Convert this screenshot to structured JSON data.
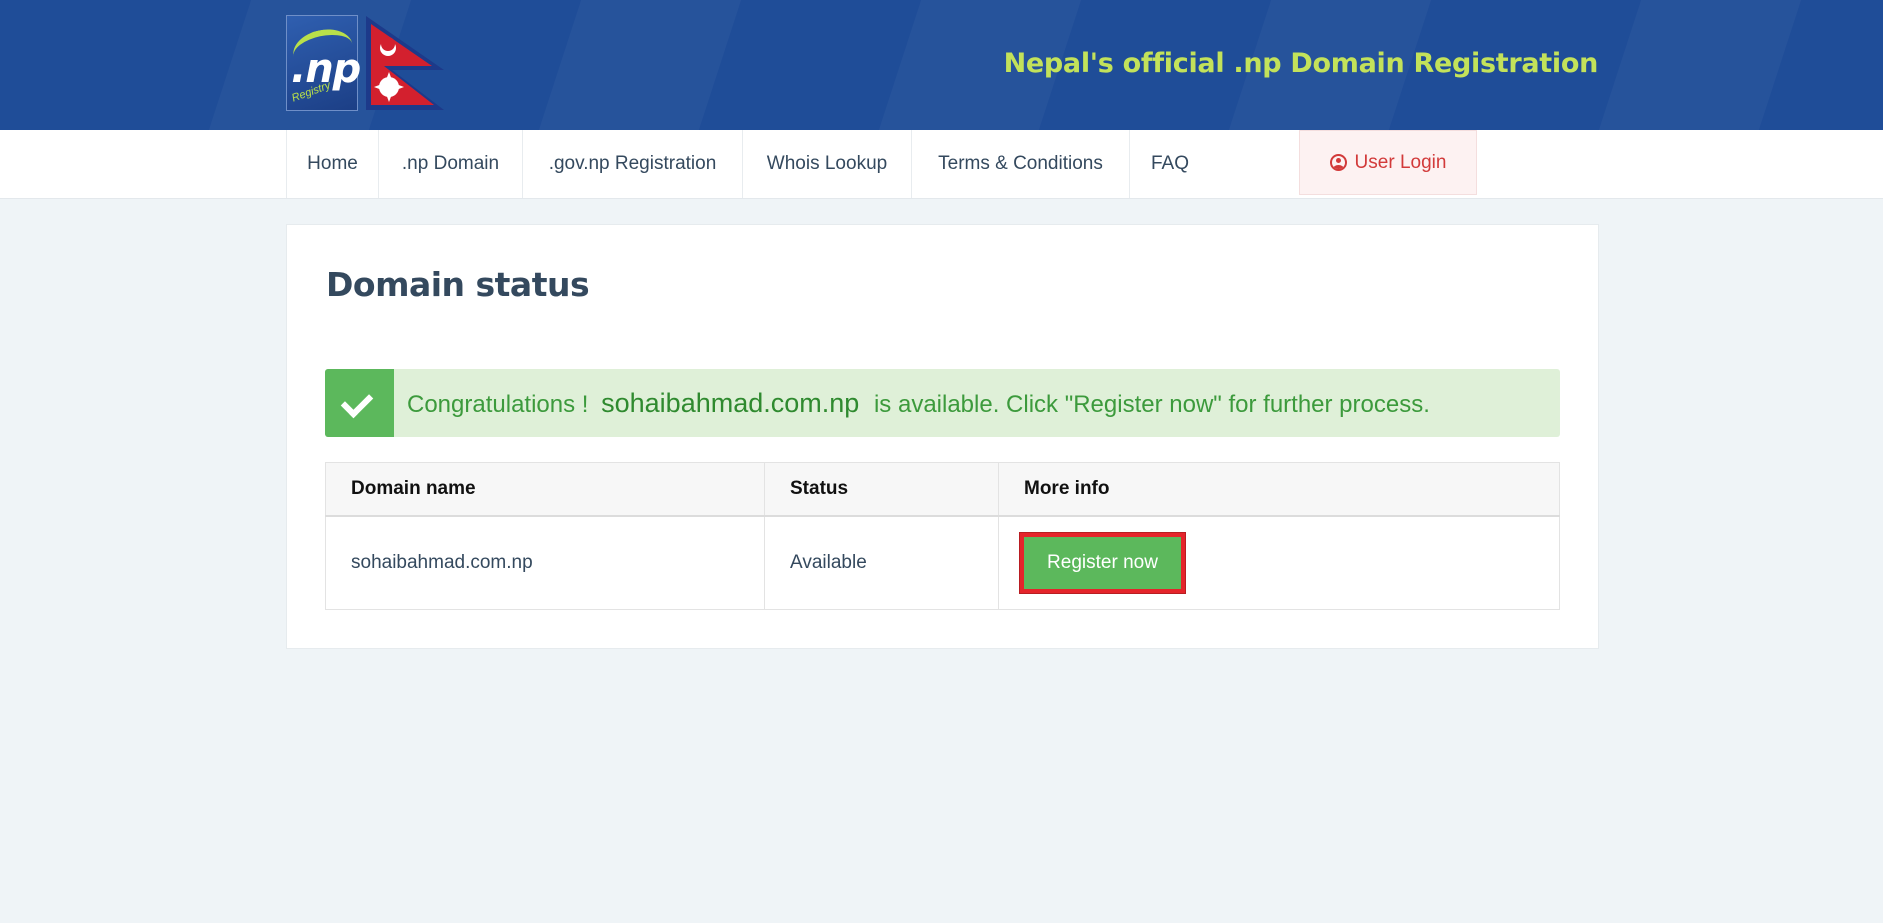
{
  "header": {
    "logo_text": ".np",
    "logo_subtext": "Registry",
    "title": "Nepal's official .np Domain Registration"
  },
  "nav": {
    "items": [
      {
        "label": "Home"
      },
      {
        "label": ".np Domain"
      },
      {
        "label": ".gov.np Registration"
      },
      {
        "label": "Whois Lookup"
      },
      {
        "label": "Terms & Conditions"
      },
      {
        "label": "FAQ"
      }
    ],
    "login_label": "User Login"
  },
  "main": {
    "title": "Domain status",
    "alert": {
      "prefix": "Congratulations !",
      "domain": "sohaibahmad.com.np",
      "suffix": "is available. Click \"Register now\" for further process."
    },
    "table": {
      "headers": [
        "Domain name",
        "Status",
        "More info"
      ],
      "rows": [
        {
          "domain": "sohaibahmad.com.np",
          "status": "Available",
          "action": "Register now"
        }
      ]
    }
  },
  "colors": {
    "header_bg": "#1f4d98",
    "header_title": "#c3e25a",
    "success": "#5cb85c",
    "alert_bg": "#dff0d8",
    "login_text": "#d23a3a",
    "highlight_border": "#e5242b"
  }
}
